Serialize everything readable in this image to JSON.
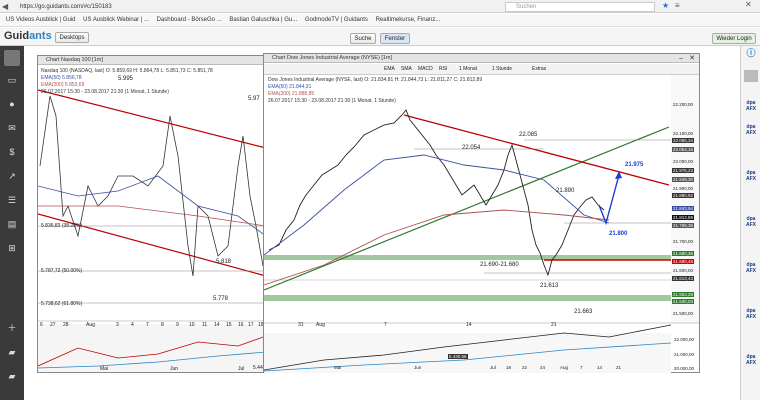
{
  "browser": {
    "url": "https://go.guidants.com/#c/150183",
    "search_placeholder": "Suchen"
  },
  "bookmarks": [
    "US Videos Ausblick | Guid",
    "US Ausblick Webinar | ...",
    "Dashboard - BörseGo ...",
    "Bastian Galuschka | Gu...",
    "GodmodeTV | Guidants",
    "Realtimekurse, Finanz..."
  ],
  "app": {
    "logo_a": "Guid",
    "logo_b": "ants",
    "desktop_label": "Desktops",
    "suche_label": "Suche",
    "fenster_label": "Fenster",
    "login_label": "Wieder Login"
  },
  "left_chart": {
    "title": "Chart Nasdaq 100 [1m]",
    "legend1": "Nasdaq 100 (NASDAQ, last)  O: 5.859,69  H: 5.864,78  L: 5.851,73  C: 5.851,78",
    "legend2": "EMA(50)  5.856,78",
    "legend3": "EMA(200)  5.853,69",
    "legend4": "26.07.2017 15:30 - 23.08.2017 21:30  (1 Monat, 1 Stunde)",
    "labels": [
      "5.995",
      "5.97",
      "5.836,83 (38.20%)",
      "5.818",
      "5.787,72 (50.00%)",
      "5.778",
      "5.738,62 (61.80%)",
      "5.440"
    ],
    "xticks": [
      "6",
      "27",
      "28",
      "Aug",
      "3",
      "4",
      "7",
      "8",
      "9",
      "10",
      "11",
      "14",
      "15",
      "16",
      "17",
      "18"
    ],
    "sub_labels": [
      "Mai",
      "Jun",
      "Jul"
    ]
  },
  "main_chart": {
    "title": "Chart Dow Jones Industrial Average (NYSE) [1m]",
    "legend1": "Dow Jones Industrial Average (NYSE, last)  O: 21.834,81  H: 21.844,73  L: 21.811,27  C: 21.812,89",
    "legend2": "EMA(50)  21.844,31",
    "legend3": "EMA(200)  21.888,85",
    "legend4": "26.07.2017 15:30 - 23.08.2017 21:30  (1 Monat, 1 Stunde)",
    "toolbar": [
      "EMA",
      "SMA",
      "MACD",
      "RSI",
      "1 Monat",
      "1 Stunde",
      "Extras"
    ],
    "annotations": [
      "22.085",
      "22.054",
      "21.975",
      "21.890",
      "21.800",
      "21.690-21.680",
      "21.613",
      "21.663"
    ],
    "price_axis": [
      "22.200,00",
      "22.100,00",
      "22.085,34",
      "22.054,15",
      "22.000,00",
      "21.976,23",
      "21.949,30",
      "21.900,00",
      "21.890,92",
      "21.843,94",
      "21.812,89",
      "21.789,35",
      "21.700,00",
      "21.690,36",
      "21.680,48",
      "21.600,00",
      "21.613,43",
      "21.553,28",
      "21.530,03",
      "21.500,00"
    ],
    "xticks": [
      "31",
      "Aug",
      "7",
      "14",
      "21"
    ],
    "sub_price": [
      "22.000,00",
      "21.000,00",
      "20.000,00"
    ],
    "sub_xticks": [
      "Mai",
      "Jun",
      "Jul",
      "19",
      "22",
      "24",
      "Aug",
      "7",
      "14",
      "21"
    ],
    "sub_box": "5.430,56"
  },
  "right_nav": [
    "dpa AFX",
    "dpa AFX",
    "dpa AFX",
    "dpa AFX",
    "dpa AFX",
    "dpa AFX",
    "dpa AFX"
  ]
}
